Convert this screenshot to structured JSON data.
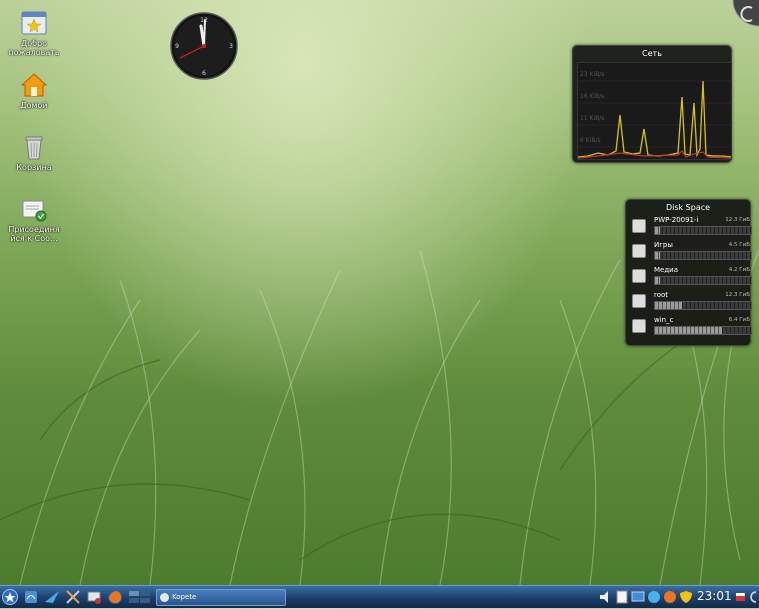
{
  "desktop_icons": [
    {
      "label_line1": "Добро",
      "label_line2": "пожаловать",
      "icon": "welcome-icon"
    },
    {
      "label_line1": "Домой",
      "label_line2": "",
      "icon": "home-icon"
    },
    {
      "label_line1": "Корзина",
      "label_line2": "",
      "icon": "trash-icon"
    },
    {
      "label_line1": "Присоединя",
      "label_line2": "йся к Соо...",
      "icon": "join-community-icon"
    }
  ],
  "network_widget": {
    "title": "Сеть",
    "y_ticks": [
      "23 KiB/s",
      "16 KiB/s",
      "11 KiB/s",
      "6 KiB/s"
    ]
  },
  "disk_widget": {
    "title": "Disk Space",
    "disks": [
      {
        "name": "PWP-20091-i",
        "size": "12.3 ГиБ",
        "used_fraction": 0.05
      },
      {
        "name": "Игры",
        "size": "4.5 ГиБ",
        "used_fraction": 0.05
      },
      {
        "name": "Медиа",
        "size": "4.2 ГиБ",
        "used_fraction": 0.05
      },
      {
        "name": "root",
        "size": "12.3 ГиБ",
        "used_fraction": 0.28
      },
      {
        "name": "win_c",
        "size": "6.4 ГиБ",
        "used_fraction": 0.7
      }
    ]
  },
  "taskbar": {
    "task_label": "Kopete",
    "clock": "23:01"
  },
  "colors": {
    "accent": "#3a6ea5",
    "net_line": "#d4c21a",
    "net_fill": "#c0392b"
  }
}
